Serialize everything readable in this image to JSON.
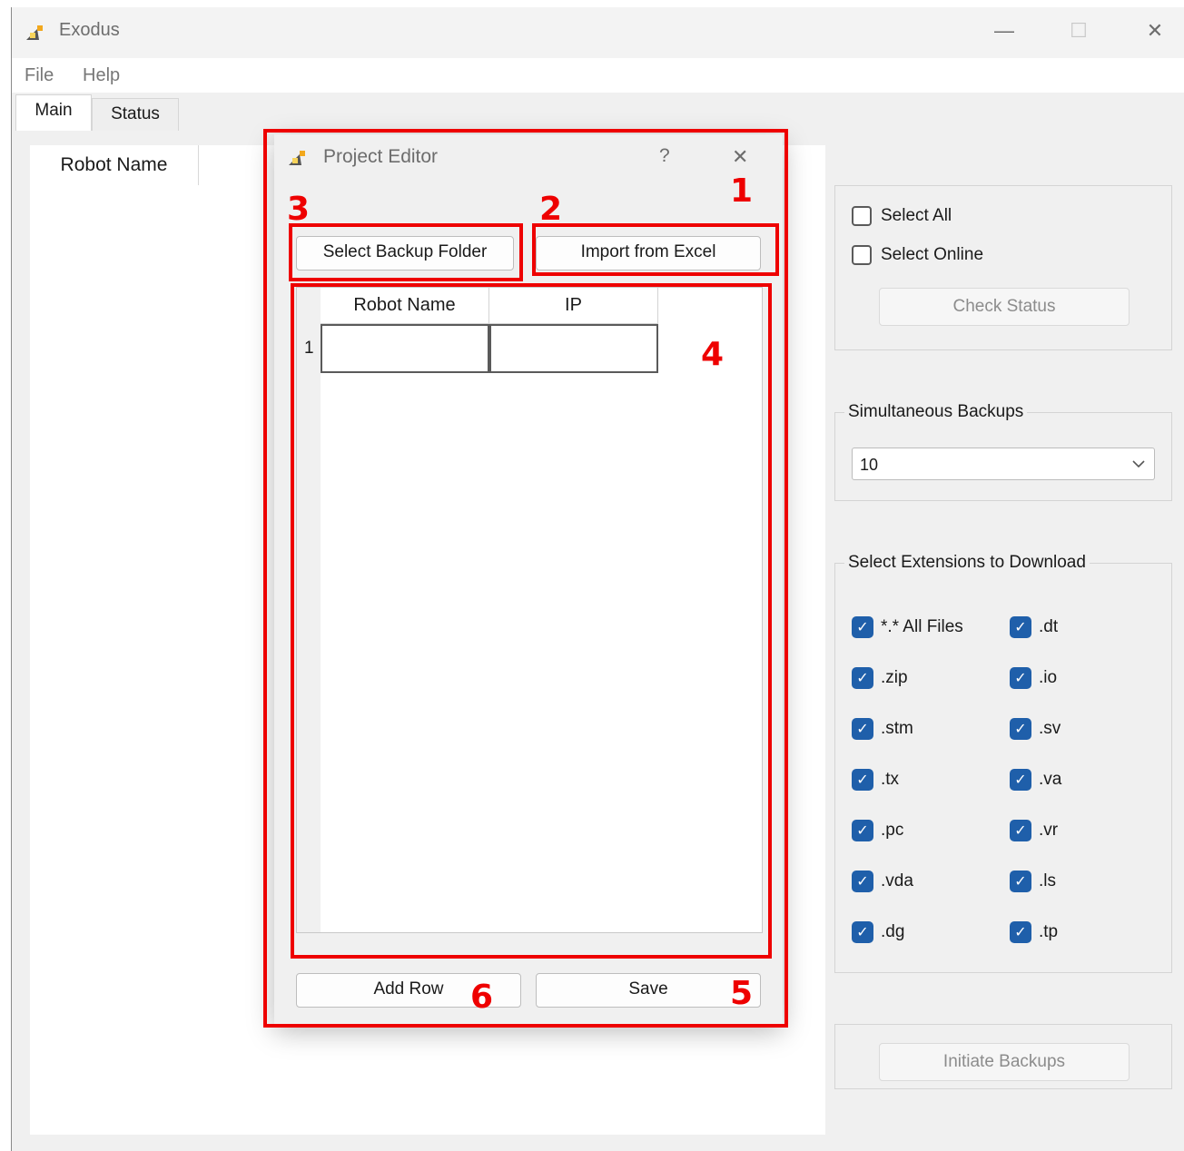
{
  "window": {
    "title": "Exodus",
    "controls": {
      "minimize": "—",
      "maximize": "☐",
      "close": "✕"
    }
  },
  "menu": [
    "File",
    "Help"
  ],
  "tabs": [
    {
      "label": "Main",
      "active": true
    },
    {
      "label": "Status",
      "active": false
    }
  ],
  "main": {
    "left_column_header": "Robot Name"
  },
  "select_group": {
    "select_all": {
      "label": "Select All",
      "checked": false
    },
    "select_online": {
      "label": "Select Online",
      "checked": false
    },
    "check_status": "Check Status"
  },
  "simultaneous": {
    "title": "Simultaneous Backups",
    "value": "10"
  },
  "extensions": {
    "title": "Select Extensions to Download",
    "items": [
      {
        "label": "*.* All Files",
        "checked": true
      },
      {
        "label": ".dt",
        "checked": true
      },
      {
        "label": ".zip",
        "checked": true
      },
      {
        "label": ".io",
        "checked": true
      },
      {
        "label": ".stm",
        "checked": true
      },
      {
        "label": ".sv",
        "checked": true
      },
      {
        "label": ".tx",
        "checked": true
      },
      {
        "label": ".va",
        "checked": true
      },
      {
        "label": ".pc",
        "checked": true
      },
      {
        "label": ".vr",
        "checked": true
      },
      {
        "label": ".vda",
        "checked": true
      },
      {
        "label": ".ls",
        "checked": true
      },
      {
        "label": ".dg",
        "checked": true
      },
      {
        "label": ".tp",
        "checked": true
      }
    ]
  },
  "initiate": "Initiate Backups",
  "dialog": {
    "title": "Project Editor",
    "help": "?",
    "close": "✕",
    "select_backup_folder": "Select Backup Folder",
    "import_excel": "Import from Excel",
    "table": {
      "headers": [
        "Robot Name",
        "IP"
      ],
      "rows": [
        {
          "num": "1",
          "robot_name": "",
          "ip": ""
        }
      ]
    },
    "add_row": "Add Row",
    "save": "Save"
  },
  "annotations": [
    "1",
    "2",
    "3",
    "4",
    "5",
    "6"
  ],
  "colors": {
    "annotation": "#ee0000",
    "checkbox_accent": "#1f5faa"
  }
}
